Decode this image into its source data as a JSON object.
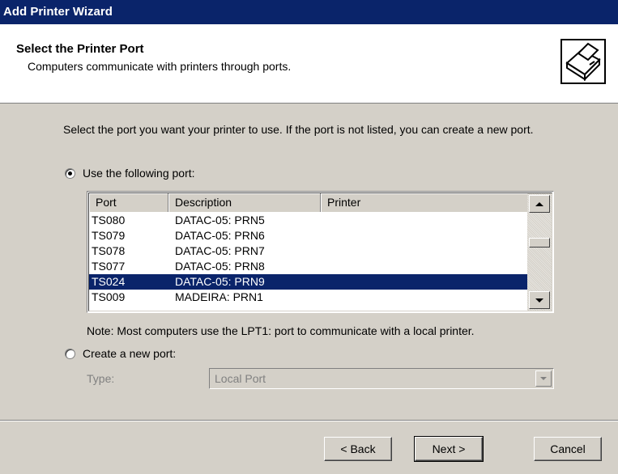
{
  "window": {
    "title": "Add Printer Wizard"
  },
  "header": {
    "title": "Select the Printer Port",
    "subtitle": "Computers communicate with printers through ports."
  },
  "intro": "Select the port you want your printer to use.  If the port is not listed, you can create a new port.",
  "use_port": {
    "label": "Use the following port:",
    "checked": true
  },
  "port_list": {
    "columns": [
      "Port",
      "Description",
      "Printer"
    ],
    "rows": [
      {
        "port": "TS080",
        "description": "DATAC-05:  PRN5",
        "printer": ""
      },
      {
        "port": "TS079",
        "description": "DATAC-05:  PRN6",
        "printer": ""
      },
      {
        "port": "TS078",
        "description": "DATAC-05:  PRN7",
        "printer": ""
      },
      {
        "port": "TS077",
        "description": "DATAC-05:  PRN8",
        "printer": ""
      },
      {
        "port": "TS024",
        "description": "DATAC-05:  PRN9",
        "printer": ""
      },
      {
        "port": "TS009",
        "description": "MADEIRA:  PRN1",
        "printer": ""
      }
    ],
    "selected_port": "TS024"
  },
  "note": "Note: Most computers use the LPT1: port to communicate with a local printer.",
  "create_port": {
    "label": "Create a new port:",
    "checked": false,
    "type_label": "Type:",
    "type_value": "Local Port"
  },
  "buttons": {
    "back": "< Back",
    "next": "Next >",
    "cancel": "Cancel"
  },
  "colors": {
    "title_bar": "#0a246a",
    "selection": "#0a246a",
    "face": "#d4d0c8"
  }
}
